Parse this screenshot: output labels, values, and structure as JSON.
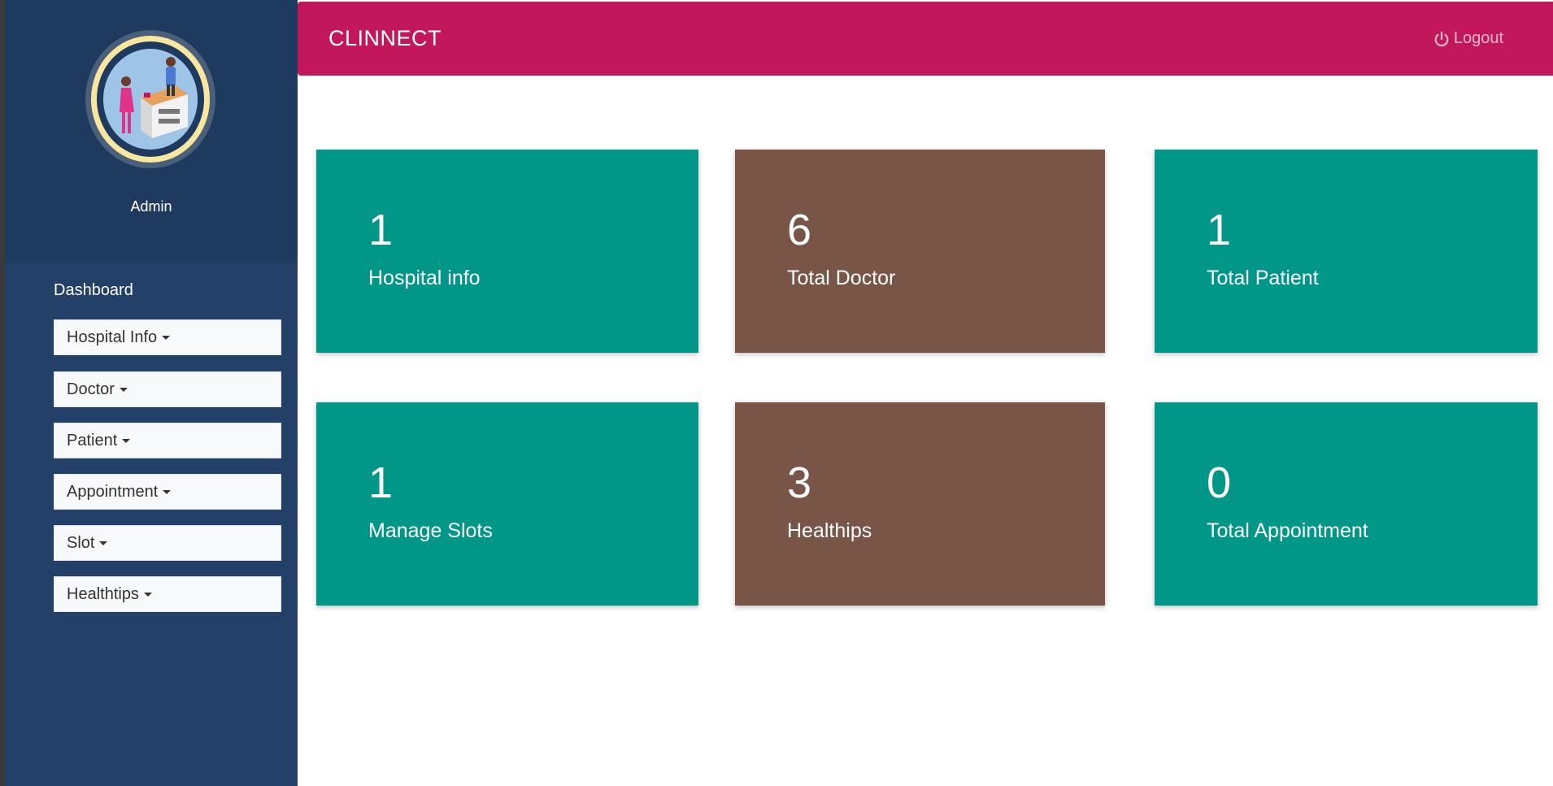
{
  "app": {
    "brand": "CLINNECT",
    "logout_label": "Logout"
  },
  "sidebar": {
    "user_name": "Admin",
    "dashboard_label": "Dashboard",
    "items": [
      {
        "label": "Hospital Info"
      },
      {
        "label": "Doctor"
      },
      {
        "label": "Patient"
      },
      {
        "label": "Appointment"
      },
      {
        "label": "Slot"
      },
      {
        "label": "Healthtips"
      }
    ]
  },
  "cards": [
    {
      "value": "1",
      "label": "Hospital info",
      "color": "#009688"
    },
    {
      "value": "6",
      "label": "Total Doctor",
      "color": "#795548"
    },
    {
      "value": "1",
      "label": "Total Patient",
      "color": "#009688"
    },
    {
      "value": "1",
      "label": "Manage Slots",
      "color": "#009688"
    },
    {
      "value": "3",
      "label": "Healthips",
      "color": "#795548"
    },
    {
      "value": "0",
      "label": "Total Appointment",
      "color": "#009688"
    }
  ],
  "colors": {
    "sidebar": "#224068",
    "topbar": "#c2185b",
    "teal": "#009688",
    "brown": "#795548"
  }
}
